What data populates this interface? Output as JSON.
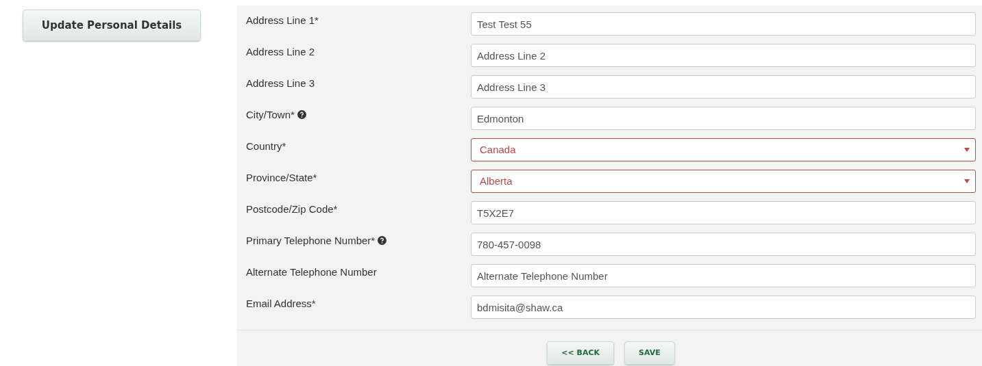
{
  "sidebar": {
    "button": "Update Personal Details"
  },
  "fields": [
    {
      "kind": "text",
      "label": "Address Line 1*",
      "help": false,
      "invalid": false,
      "value": "Test Test 55"
    },
    {
      "kind": "text",
      "label": "Address Line 2",
      "help": false,
      "invalid": false,
      "placeholder": "Address Line 2"
    },
    {
      "kind": "text",
      "label": "Address Line 3",
      "help": false,
      "invalid": false,
      "placeholder": "Address Line 3"
    },
    {
      "kind": "text",
      "label": "City/Town*",
      "help": true,
      "invalid": false,
      "value": "Edmonton"
    },
    {
      "kind": "select",
      "label": "Country*",
      "help": false,
      "invalid": true,
      "value": "Canada"
    },
    {
      "kind": "select",
      "label": "Province/State*",
      "help": false,
      "invalid": true,
      "value": "Alberta"
    },
    {
      "kind": "text",
      "label": "Postcode/Zip Code*",
      "help": false,
      "invalid": false,
      "value": "T5X2E7"
    },
    {
      "kind": "text",
      "label": "Primary Telephone Number*",
      "help": true,
      "invalid": false,
      "value": "780-457-0098"
    },
    {
      "kind": "text",
      "label": "Alternate Telephone Number",
      "help": false,
      "invalid": false,
      "placeholder": "Alternate Telephone Number"
    },
    {
      "kind": "text",
      "label": "Email Address*",
      "help": false,
      "invalid": false,
      "value": "bdmisita@shaw.ca"
    }
  ],
  "buttons": [
    "<< BACK",
    "SAVE"
  ]
}
